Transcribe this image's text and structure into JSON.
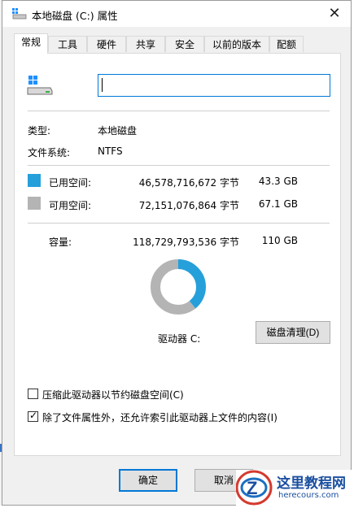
{
  "window": {
    "title": "本地磁盘 (C:) 属性"
  },
  "tabs": [
    {
      "label": "常规",
      "active": true
    },
    {
      "label": "工具"
    },
    {
      "label": "硬件"
    },
    {
      "label": "共享"
    },
    {
      "label": "安全"
    },
    {
      "label": "以前的版本"
    },
    {
      "label": "配额"
    }
  ],
  "general": {
    "volume_name_value": "",
    "type_label": "类型:",
    "type_value": "本地磁盘",
    "fs_label": "文件系统:",
    "fs_value": "NTFS",
    "used": {
      "label": "已用空间:",
      "bytes": "46,578,716,672 字节",
      "size": "43.3 GB",
      "color": "#26a0da"
    },
    "free": {
      "label": "可用空间:",
      "bytes": "72,151,076,864 字节",
      "size": "67.1 GB",
      "color": "#b4b4b4"
    },
    "capacity": {
      "label": "容量:",
      "bytes": "118,729,793,536 字节",
      "size": "110 GB"
    },
    "drive_label": "驱动器 C:",
    "cleanup_button": "磁盘清理(D)",
    "compress_checkbox": {
      "label": "压缩此驱动器以节约磁盘空间(C)",
      "checked": false
    },
    "index_checkbox": {
      "label": "除了文件属性外，还允许索引此驱动器上文件的内容(I)",
      "checked": true
    }
  },
  "chart_data": {
    "type": "pie",
    "categories": [
      "已用空间",
      "可用空间"
    ],
    "values": [
      43.3,
      67.1
    ],
    "colors": [
      "#26a0da",
      "#b4b4b4"
    ]
  },
  "buttons": {
    "ok": "确定",
    "cancel": "取消"
  },
  "watermark": {
    "site_cn": "这里教程网",
    "site_en": "herecours.com"
  },
  "icons": {
    "close": "close-icon",
    "drive": "drive-icon",
    "title": "drive-icon"
  }
}
